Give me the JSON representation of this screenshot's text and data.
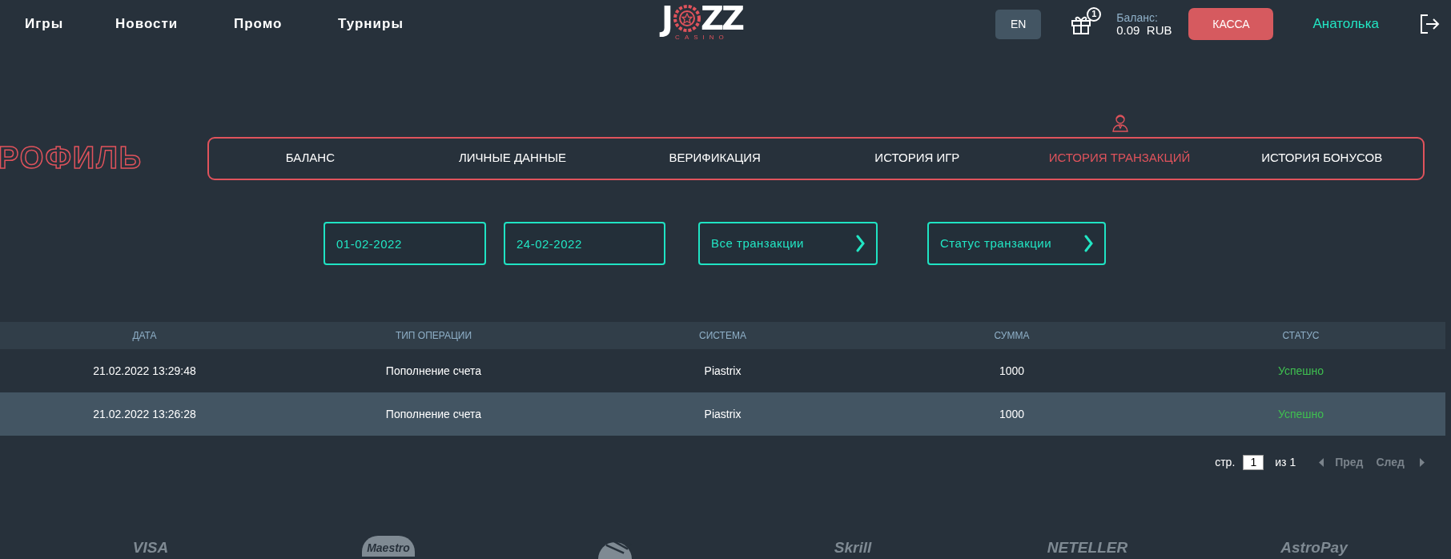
{
  "nav": [
    {
      "label": "Игры"
    },
    {
      "label": "Новости"
    },
    {
      "label": "Промо"
    },
    {
      "label": "Турниры"
    }
  ],
  "logo": {
    "left": "J",
    "right": "ZZ",
    "subtitle": "CASINO"
  },
  "language": "EN",
  "gift": {
    "badge": "1"
  },
  "balance": {
    "label": "Баланс:",
    "value": "0.09  RUB"
  },
  "cashier_button": "КАССА",
  "user": "Анатолька",
  "profile_title": "РОФИЛЬ",
  "tabs": [
    {
      "label": "БАЛАНС",
      "selected": false
    },
    {
      "label": "ЛИЧНЫЕ ДАННЫЕ",
      "selected": false
    },
    {
      "label": "ВЕРИФИКАЦИЯ",
      "selected": false
    },
    {
      "label": "ИСТОРИЯ ИГР",
      "selected": false
    },
    {
      "label": "ИСТОРИЯ ТРАНЗАКЦИЙ",
      "selected": true
    },
    {
      "label": "ИСТОРИЯ БОНУСОВ",
      "selected": false
    }
  ],
  "filters": [
    {
      "kind": "date",
      "value": "01-02-2022"
    },
    {
      "kind": "date",
      "value": "24-02-2022"
    },
    {
      "kind": "select",
      "label": "Все транзакции"
    },
    {
      "kind": "select",
      "label": "Статус транзакции"
    }
  ],
  "table": {
    "columns": [
      "ДАТА",
      "ТИП ОПЕРАЦИИ",
      "СИСТЕМА",
      "СУММА",
      "СТАТУС"
    ],
    "rows": [
      {
        "cells": [
          "21.02.2022 13:29:48",
          "Пополнение счета",
          "Piastrix",
          "1000",
          "Успешно"
        ],
        "highlighted": false
      },
      {
        "cells": [
          "21.02.2022 13:26:28",
          "Пополнение счета",
          "Piastrix",
          "1000",
          "Успешно"
        ],
        "highlighted": true
      }
    ]
  },
  "pagination": {
    "label": "стр.",
    "page": "1",
    "total": "из 1",
    "prev": {
      "label": "Пред",
      "disabled": true
    },
    "next": {
      "label": "След",
      "disabled": true
    }
  },
  "payment_methods": [
    {
      "kind": "text",
      "label": "VISA"
    },
    {
      "kind": "text",
      "label": "Maestro"
    },
    {
      "kind": "globe"
    },
    {
      "kind": "text",
      "label": "Skrill"
    },
    {
      "kind": "text",
      "label": "NETELLER"
    },
    {
      "kind": "text",
      "label": "AstroPay"
    }
  ]
}
